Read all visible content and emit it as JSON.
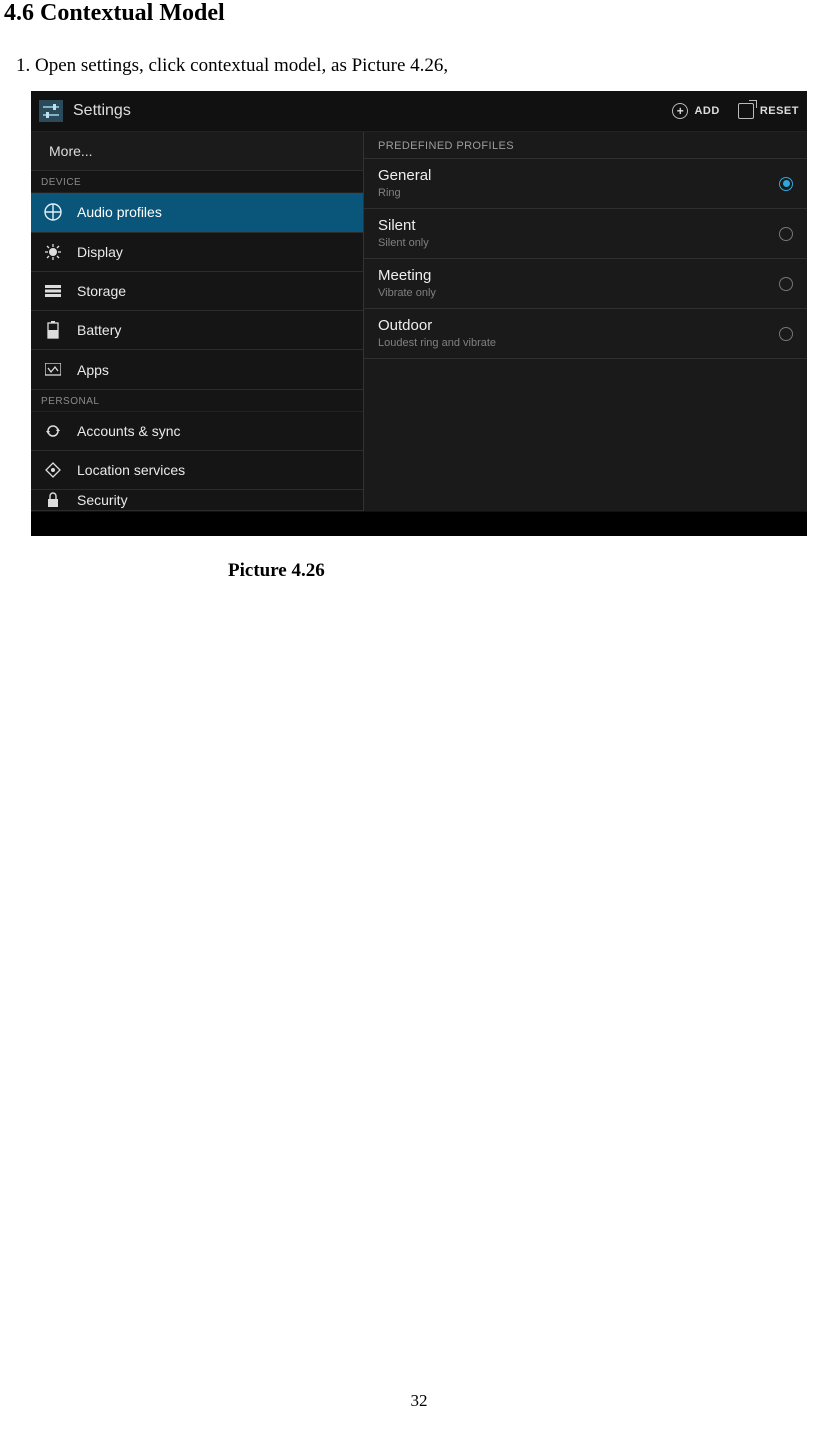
{
  "doc": {
    "section_heading": "4.6 Contextual Model",
    "instruction": "1. Open settings, click contextual model, as Picture 4.26,",
    "caption": "Picture 4.26",
    "page_number": "32"
  },
  "topbar": {
    "title": "Settings",
    "add_label": "ADD",
    "reset_label": "RESET"
  },
  "sidebar": {
    "more_label": "More...",
    "device_header": "DEVICE",
    "personal_header": "PERSONAL",
    "items": {
      "audio_profiles": "Audio profiles",
      "display": "Display",
      "storage": "Storage",
      "battery": "Battery",
      "apps": "Apps",
      "accounts_sync": "Accounts & sync",
      "location_services": "Location services",
      "security": "Security"
    }
  },
  "detail": {
    "header": "PREDEFINED PROFILES",
    "profiles": {
      "general": {
        "title": "General",
        "subtitle": "Ring"
      },
      "silent": {
        "title": "Silent",
        "subtitle": "Silent only"
      },
      "meeting": {
        "title": "Meeting",
        "subtitle": "Vibrate only"
      },
      "outdoor": {
        "title": "Outdoor",
        "subtitle": "Loudest ring and vibrate"
      }
    }
  }
}
